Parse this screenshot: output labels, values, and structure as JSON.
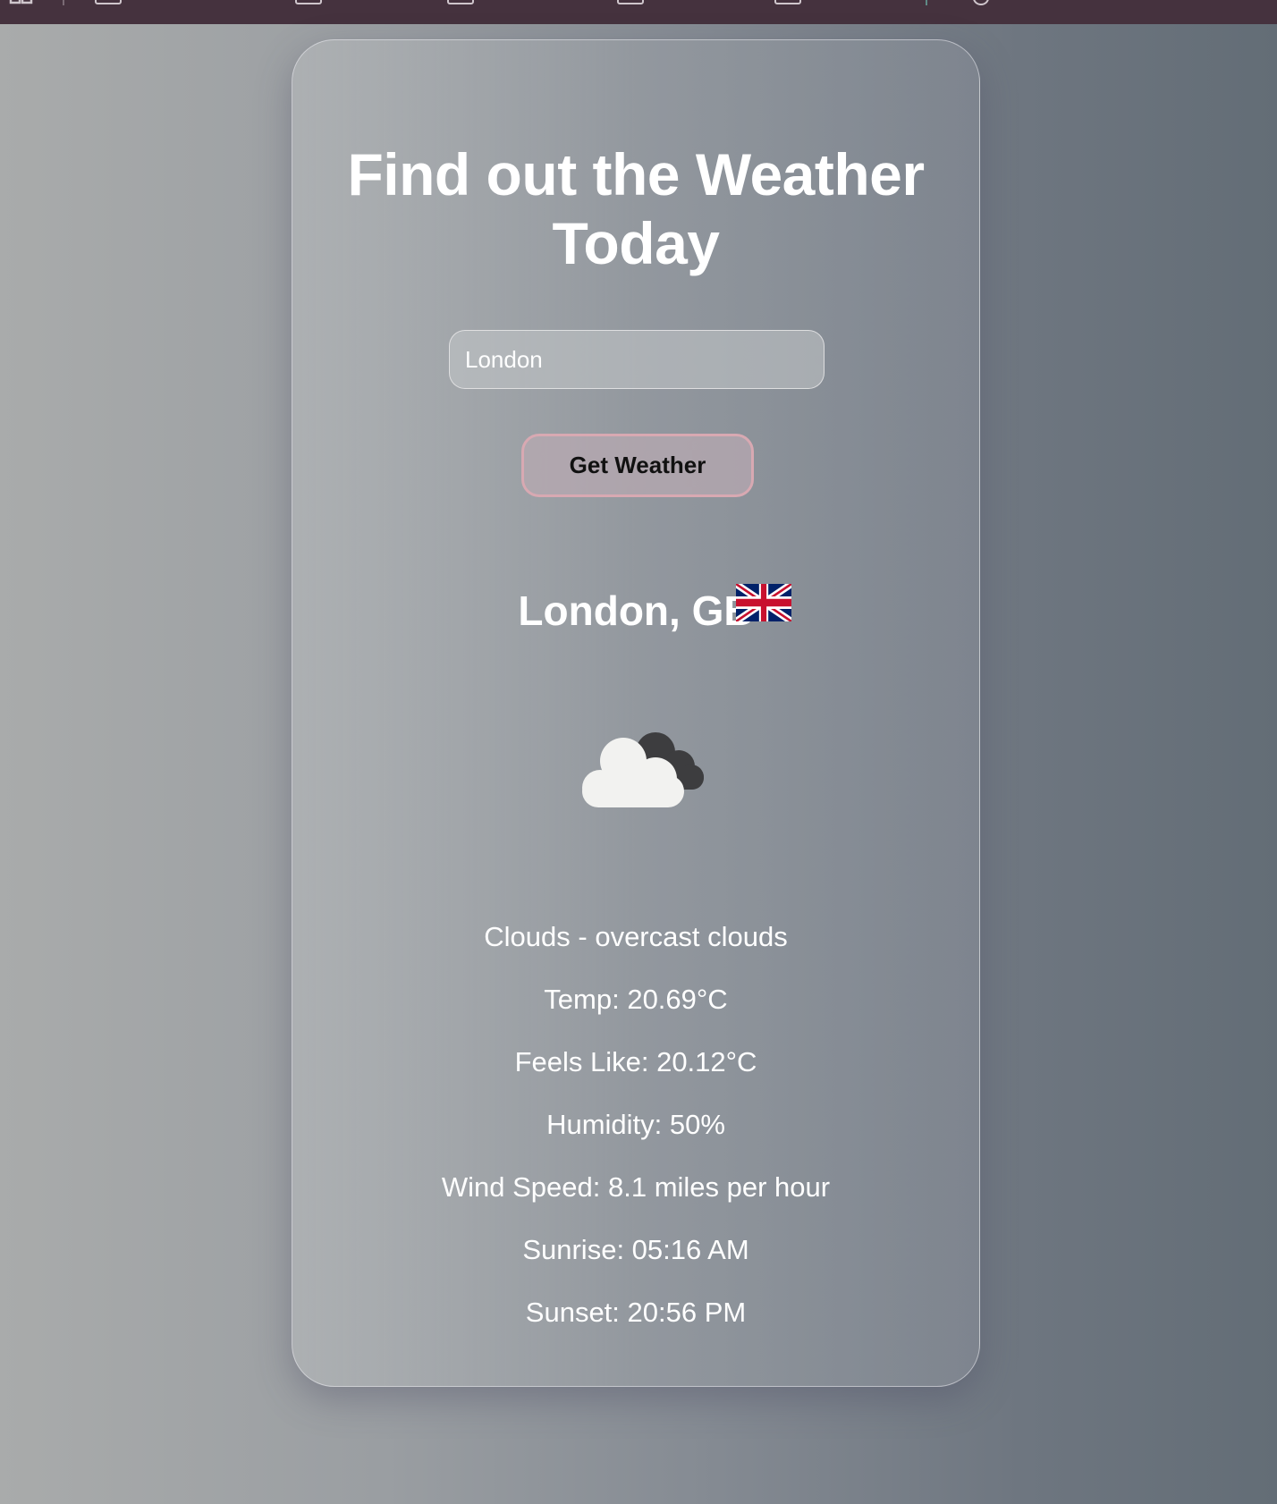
{
  "title": "Find out the Weather Today",
  "search": {
    "value": "London",
    "button_label": "Get Weather"
  },
  "location": {
    "label": "London, GB",
    "flag_icon": "uk-flag-icon"
  },
  "weather_icon": "overcast-clouds-icon",
  "details": {
    "description": "Clouds - overcast clouds",
    "temp": "Temp: 20.69°C",
    "feels_like": "Feels Like: 20.12°C",
    "humidity": "Humidity: 50%",
    "wind_speed": "Wind Speed: 8.1 miles per hour",
    "sunrise": "Sunrise: 05:16 AM",
    "sunset": "Sunset: 20:56 PM"
  },
  "colors": {
    "topbar": "#45323e",
    "button_border": "#d8a9b2",
    "text": "#ffffff"
  }
}
